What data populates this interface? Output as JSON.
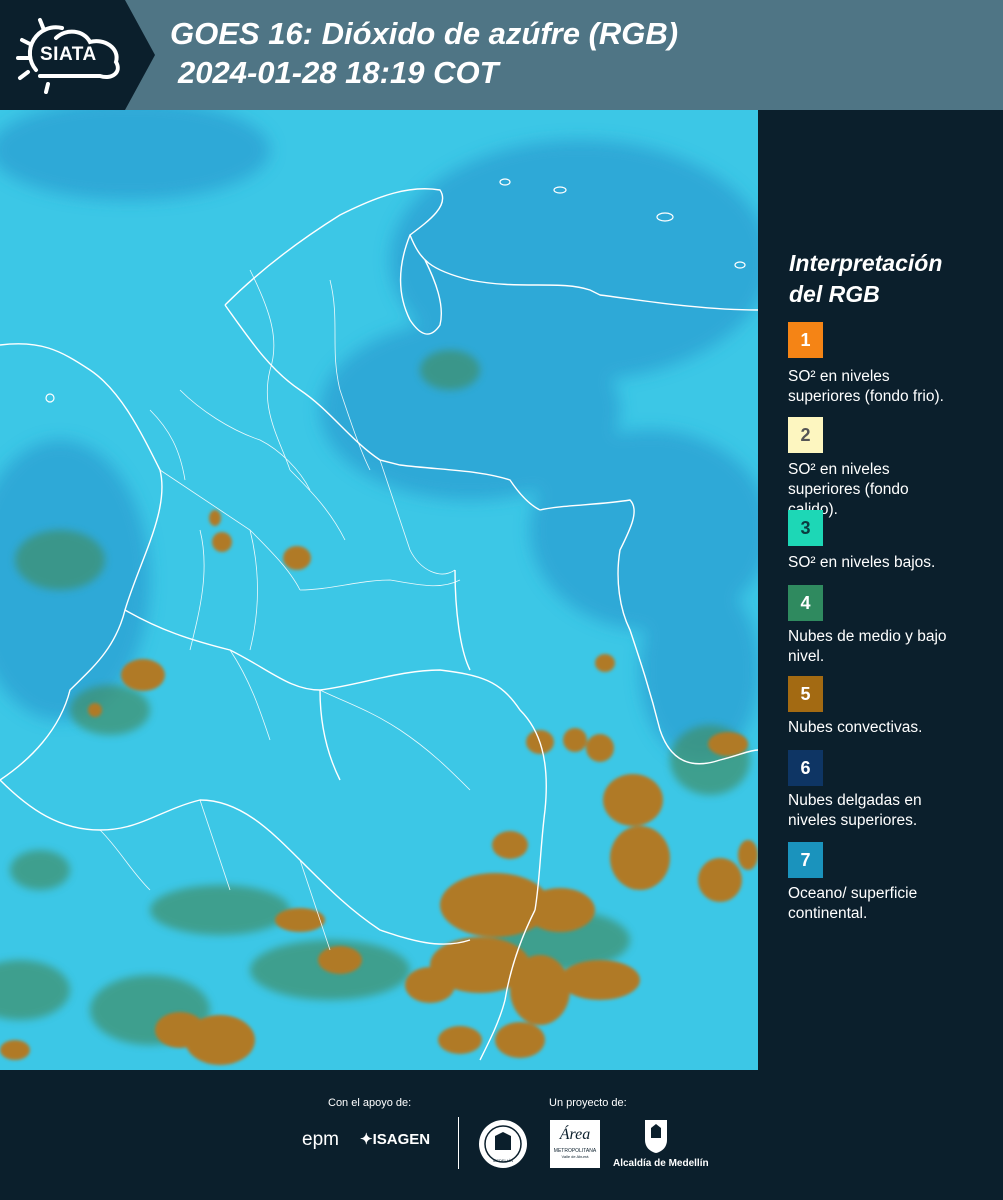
{
  "header": {
    "logo_text": "SIATA",
    "title": "GOES 16: Dióxido de azúfre (RGB)",
    "datetime": "2024-01-28 18:19 COT"
  },
  "legend": {
    "title_line1": "Interpretación",
    "title_line2": "del RGB",
    "items": [
      {
        "number": "1",
        "color": "#f58415",
        "text_color": "#ffffff",
        "lines": [
          "SO² en niveles",
          "superiores (fondo frio)."
        ]
      },
      {
        "number": "2",
        "color": "#fdf6c0",
        "text_color": "#555555",
        "lines": [
          "SO² en niveles",
          "superiores (fondo",
          "calido)."
        ]
      },
      {
        "number": "3",
        "color": "#1dd7b6",
        "text_color": "#0b3b40",
        "lines": [
          "SO² en niveles bajos."
        ]
      },
      {
        "number": "4",
        "color": "#2f8a5f",
        "text_color": "#ffffff",
        "lines": [
          "Nubes de medio y bajo",
          "nivel."
        ]
      },
      {
        "number": "5",
        "color": "#a36a12",
        "text_color": "#ffffff",
        "lines": [
          "Nubes convectivas."
        ]
      },
      {
        "number": "6",
        "color": "#0e3564",
        "text_color": "#ffffff",
        "lines": [
          "Nubes delgadas en",
          "niveles superiores."
        ]
      },
      {
        "number": "7",
        "color": "#1a93bd",
        "text_color": "#ffffff",
        "lines": [
          "Oceano/ superficie",
          "continental."
        ]
      }
    ]
  },
  "footer": {
    "support_label": "Con el apoyo de:",
    "project_label": "Un proyecto de:",
    "sponsors": [
      "epm",
      "ISAGEN"
    ],
    "partner_area_name": "Área",
    "partner_area_sub1": "METROPOLITANA",
    "partner_area_sub2": "Valle de Aburrá",
    "partner_alcaldia": "Alcaldía de Medellín",
    "partner_seal_text": "MEDELLÍN"
  },
  "map": {
    "colors": {
      "background": "#3cc7e6",
      "thin_cloud": "#2aa3d4",
      "low_cloud": "#3f8f6a",
      "convective": "#b07a26",
      "border": "#ffffff"
    }
  }
}
